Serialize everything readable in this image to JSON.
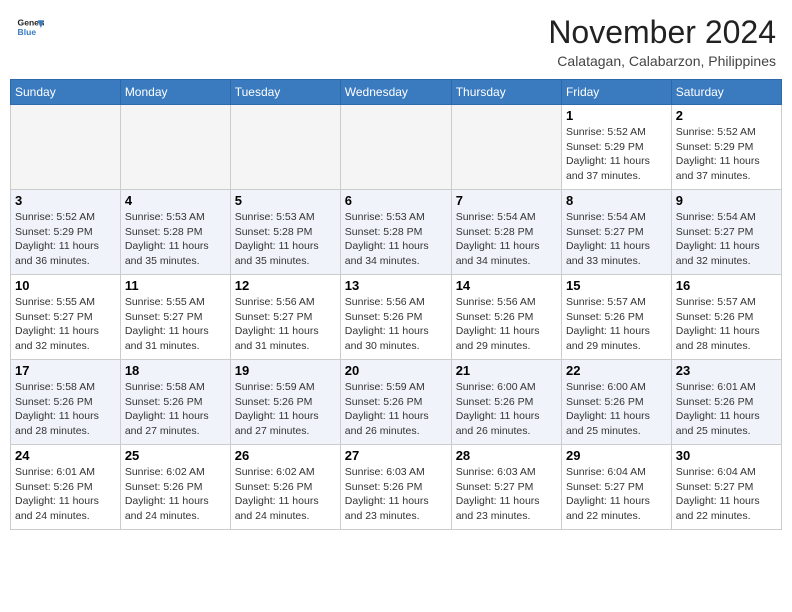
{
  "header": {
    "logo_line1": "General",
    "logo_line2": "Blue",
    "month": "November 2024",
    "location": "Calatagan, Calabarzon, Philippines"
  },
  "weekdays": [
    "Sunday",
    "Monday",
    "Tuesday",
    "Wednesday",
    "Thursday",
    "Friday",
    "Saturday"
  ],
  "weeks": [
    [
      {
        "day": "",
        "info": ""
      },
      {
        "day": "",
        "info": ""
      },
      {
        "day": "",
        "info": ""
      },
      {
        "day": "",
        "info": ""
      },
      {
        "day": "",
        "info": ""
      },
      {
        "day": "1",
        "info": "Sunrise: 5:52 AM\nSunset: 5:29 PM\nDaylight: 11 hours and 37 minutes."
      },
      {
        "day": "2",
        "info": "Sunrise: 5:52 AM\nSunset: 5:29 PM\nDaylight: 11 hours and 37 minutes."
      }
    ],
    [
      {
        "day": "3",
        "info": "Sunrise: 5:52 AM\nSunset: 5:29 PM\nDaylight: 11 hours and 36 minutes."
      },
      {
        "day": "4",
        "info": "Sunrise: 5:53 AM\nSunset: 5:28 PM\nDaylight: 11 hours and 35 minutes."
      },
      {
        "day": "5",
        "info": "Sunrise: 5:53 AM\nSunset: 5:28 PM\nDaylight: 11 hours and 35 minutes."
      },
      {
        "day": "6",
        "info": "Sunrise: 5:53 AM\nSunset: 5:28 PM\nDaylight: 11 hours and 34 minutes."
      },
      {
        "day": "7",
        "info": "Sunrise: 5:54 AM\nSunset: 5:28 PM\nDaylight: 11 hours and 34 minutes."
      },
      {
        "day": "8",
        "info": "Sunrise: 5:54 AM\nSunset: 5:27 PM\nDaylight: 11 hours and 33 minutes."
      },
      {
        "day": "9",
        "info": "Sunrise: 5:54 AM\nSunset: 5:27 PM\nDaylight: 11 hours and 32 minutes."
      }
    ],
    [
      {
        "day": "10",
        "info": "Sunrise: 5:55 AM\nSunset: 5:27 PM\nDaylight: 11 hours and 32 minutes."
      },
      {
        "day": "11",
        "info": "Sunrise: 5:55 AM\nSunset: 5:27 PM\nDaylight: 11 hours and 31 minutes."
      },
      {
        "day": "12",
        "info": "Sunrise: 5:56 AM\nSunset: 5:27 PM\nDaylight: 11 hours and 31 minutes."
      },
      {
        "day": "13",
        "info": "Sunrise: 5:56 AM\nSunset: 5:26 PM\nDaylight: 11 hours and 30 minutes."
      },
      {
        "day": "14",
        "info": "Sunrise: 5:56 AM\nSunset: 5:26 PM\nDaylight: 11 hours and 29 minutes."
      },
      {
        "day": "15",
        "info": "Sunrise: 5:57 AM\nSunset: 5:26 PM\nDaylight: 11 hours and 29 minutes."
      },
      {
        "day": "16",
        "info": "Sunrise: 5:57 AM\nSunset: 5:26 PM\nDaylight: 11 hours and 28 minutes."
      }
    ],
    [
      {
        "day": "17",
        "info": "Sunrise: 5:58 AM\nSunset: 5:26 PM\nDaylight: 11 hours and 28 minutes."
      },
      {
        "day": "18",
        "info": "Sunrise: 5:58 AM\nSunset: 5:26 PM\nDaylight: 11 hours and 27 minutes."
      },
      {
        "day": "19",
        "info": "Sunrise: 5:59 AM\nSunset: 5:26 PM\nDaylight: 11 hours and 27 minutes."
      },
      {
        "day": "20",
        "info": "Sunrise: 5:59 AM\nSunset: 5:26 PM\nDaylight: 11 hours and 26 minutes."
      },
      {
        "day": "21",
        "info": "Sunrise: 6:00 AM\nSunset: 5:26 PM\nDaylight: 11 hours and 26 minutes."
      },
      {
        "day": "22",
        "info": "Sunrise: 6:00 AM\nSunset: 5:26 PM\nDaylight: 11 hours and 25 minutes."
      },
      {
        "day": "23",
        "info": "Sunrise: 6:01 AM\nSunset: 5:26 PM\nDaylight: 11 hours and 25 minutes."
      }
    ],
    [
      {
        "day": "24",
        "info": "Sunrise: 6:01 AM\nSunset: 5:26 PM\nDaylight: 11 hours and 24 minutes."
      },
      {
        "day": "25",
        "info": "Sunrise: 6:02 AM\nSunset: 5:26 PM\nDaylight: 11 hours and 24 minutes."
      },
      {
        "day": "26",
        "info": "Sunrise: 6:02 AM\nSunset: 5:26 PM\nDaylight: 11 hours and 24 minutes."
      },
      {
        "day": "27",
        "info": "Sunrise: 6:03 AM\nSunset: 5:26 PM\nDaylight: 11 hours and 23 minutes."
      },
      {
        "day": "28",
        "info": "Sunrise: 6:03 AM\nSunset: 5:27 PM\nDaylight: 11 hours and 23 minutes."
      },
      {
        "day": "29",
        "info": "Sunrise: 6:04 AM\nSunset: 5:27 PM\nDaylight: 11 hours and 22 minutes."
      },
      {
        "day": "30",
        "info": "Sunrise: 6:04 AM\nSunset: 5:27 PM\nDaylight: 11 hours and 22 minutes."
      }
    ]
  ]
}
